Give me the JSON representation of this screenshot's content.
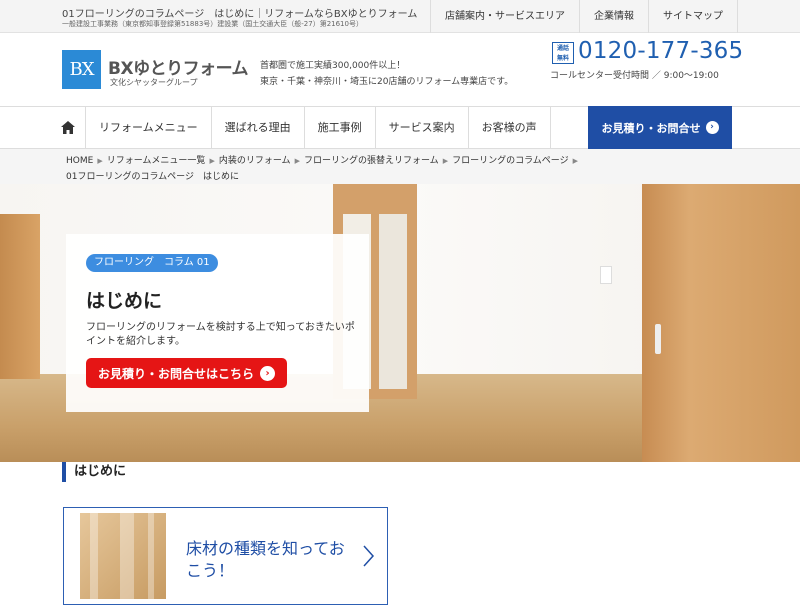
{
  "topbar": {
    "line1": "01フローリングのコラムページ　はじめに｜リフォームならBXゆとりフォーム",
    "line2": "一般建設工事業務（東京都知事登録第51883号）建設業（国土交通大臣（般-27）第21610号）",
    "nav": [
      "店舗案内・サービスエリア",
      "企業情報",
      "サイトマップ"
    ]
  },
  "header": {
    "logo_mark": "BX",
    "logo_main": "BXゆとりフォーム",
    "logo_sub": "文化シヤッターグループ",
    "tagline1": "首都圏で施工実績300,000件以上！",
    "tagline2": "東京・千葉・神奈川・埼玉に20店舗のリフォーム専業店です。",
    "tel_badge1": "通話",
    "tel_badge2": "無料",
    "tel_number": "0120-177-365",
    "tel_hours": "コールセンター受付時間 ／ 9:00～19:00"
  },
  "mainnav": {
    "items": [
      "リフォームメニュー",
      "選ばれる理由",
      "施工事例",
      "サービス案内",
      "お客様の声"
    ],
    "cta": "お見積り・お問合せ"
  },
  "breadcrumb": {
    "items": [
      "HOME",
      "リフォームメニュー一覧",
      "内装のリフォーム",
      "フローリングの張替えリフォーム",
      "フローリングのコラムページ"
    ],
    "current": "01フローリングのコラムページ　はじめに"
  },
  "hero": {
    "tag": "フローリング　コラム 01",
    "title": "はじめに",
    "desc": "フローリングのリフォームを検討する上で知っておきたいポイントを紹介します。",
    "button": "お見積り・お問合せはこちら"
  },
  "section": {
    "heading": "はじめに"
  },
  "card": {
    "title": "床材の種類を知っておこう！"
  },
  "colors": {
    "brand_blue": "#1f4ea5",
    "logo_blue": "#2b8ad6",
    "cta_red": "#e51515",
    "tag_blue": "#3d8de0"
  }
}
